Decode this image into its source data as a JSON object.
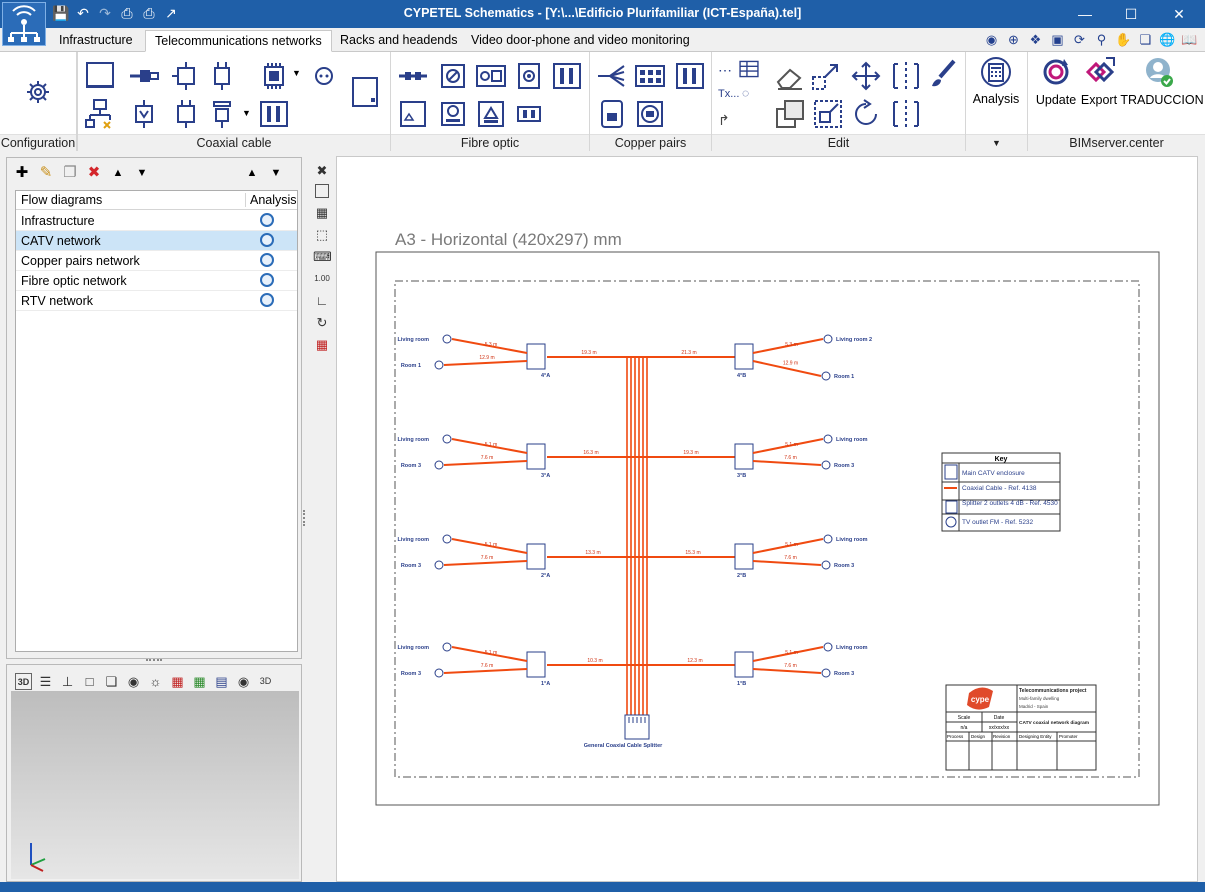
{
  "window": {
    "title": "CYPETEL Schematics - [Y:\\...\\Edificio Plurifamiliar (ICT-España).tel]",
    "minimize": "—",
    "maximize": "☐",
    "close": "✕"
  },
  "tabs": [
    {
      "label": "Infrastructure"
    },
    {
      "label": "Telecommunications networks",
      "active": true
    },
    {
      "label": "Racks and headends"
    },
    {
      "label": "Video door-phone and video monitoring"
    }
  ],
  "ribbon": {
    "groups": [
      "Configuration",
      "Coaxial cable",
      "Fibre optic",
      "Copper pairs",
      "Edit",
      "",
      "BIMserver.center"
    ],
    "analysis_label": "Analysis",
    "update_label": "Update",
    "export_label": "Export",
    "traduccion_label": "TRADUCCION",
    "edit_text_tool": "Tx..."
  },
  "flow_panel": {
    "columns": [
      "Flow diagrams",
      "Analysis"
    ],
    "rows": [
      {
        "name": "Infrastructure"
      },
      {
        "name": "CATV network",
        "selected": true
      },
      {
        "name": "Copper pairs network"
      },
      {
        "name": "Fibre optic network"
      },
      {
        "name": "RTV network"
      }
    ]
  },
  "view3d": {
    "toolbar_label": "3D"
  },
  "sheet": {
    "size_label": "A3 - Horizontal (420x297) mm",
    "riser_label": "General Coaxial Cable Splitter",
    "floors": [
      {
        "left_tag": "4°A",
        "right_tag": "4°B",
        "left_trunk": "19.3 m",
        "right_trunk": "21.3 m",
        "left_outlets": [
          "Living room",
          "Room 1"
        ],
        "right_outlets": [
          "Living room 2",
          "Room 1"
        ],
        "left_lengths": [
          "5.3 m",
          "12.9 m"
        ],
        "right_lengths": [
          "5.3 m",
          "12.9 m"
        ]
      },
      {
        "left_tag": "3°A",
        "right_tag": "3°B",
        "left_trunk": "16.3 m",
        "right_trunk": "19.3 m",
        "left_outlets": [
          "Living room",
          "Room 3"
        ],
        "right_outlets": [
          "Living room",
          "Room 3"
        ],
        "left_lengths": [
          "5.1 m",
          "7.6 m"
        ],
        "right_lengths": [
          "5.1 m",
          "7.6 m"
        ]
      },
      {
        "left_tag": "2°A",
        "right_tag": "2°B",
        "left_trunk": "13.3 m",
        "right_trunk": "15.3 m",
        "left_outlets": [
          "Living room",
          "Room 3"
        ],
        "right_outlets": [
          "Living room",
          "Room 3"
        ],
        "left_lengths": [
          "5.1 m",
          "7.6 m"
        ],
        "right_lengths": [
          "5.1 m",
          "7.6 m"
        ]
      },
      {
        "left_tag": "1°A",
        "right_tag": "1°B",
        "left_trunk": "10.3 m",
        "right_trunk": "12.3 m",
        "left_outlets": [
          "Living room",
          "Room 3"
        ],
        "right_outlets": [
          "Living room",
          "Room 3"
        ],
        "left_lengths": [
          "5.1 m",
          "7.6 m"
        ],
        "right_lengths": [
          "5.1 m",
          "7.6 m"
        ]
      }
    ],
    "key": {
      "title": "Key",
      "items": [
        "Main CATV enclosure",
        "Coaxial Cable - Ref. 4138",
        "Splitter 2 outlets 4 dB - Ref. 4530",
        "TV outlet FM - Ref. 5232"
      ]
    },
    "titleblock": {
      "logo": "cype",
      "project": "Telecommunications project",
      "line2": "Multi-family dwelling",
      "line3": "Madrid - Spain",
      "scale_label": "Scale",
      "date_label": "Date",
      "scale_value": "n/a",
      "date_value": "xx/xxx/xx",
      "drawing": "CATV coaxial network diagram",
      "process": "Process",
      "design": "Design",
      "revision": "Revision",
      "designing_entity": "Designing Entity",
      "promoter": "Promoter"
    },
    "colors": {
      "cable": "#f04a10",
      "blue": "#2a3f8a"
    }
  }
}
